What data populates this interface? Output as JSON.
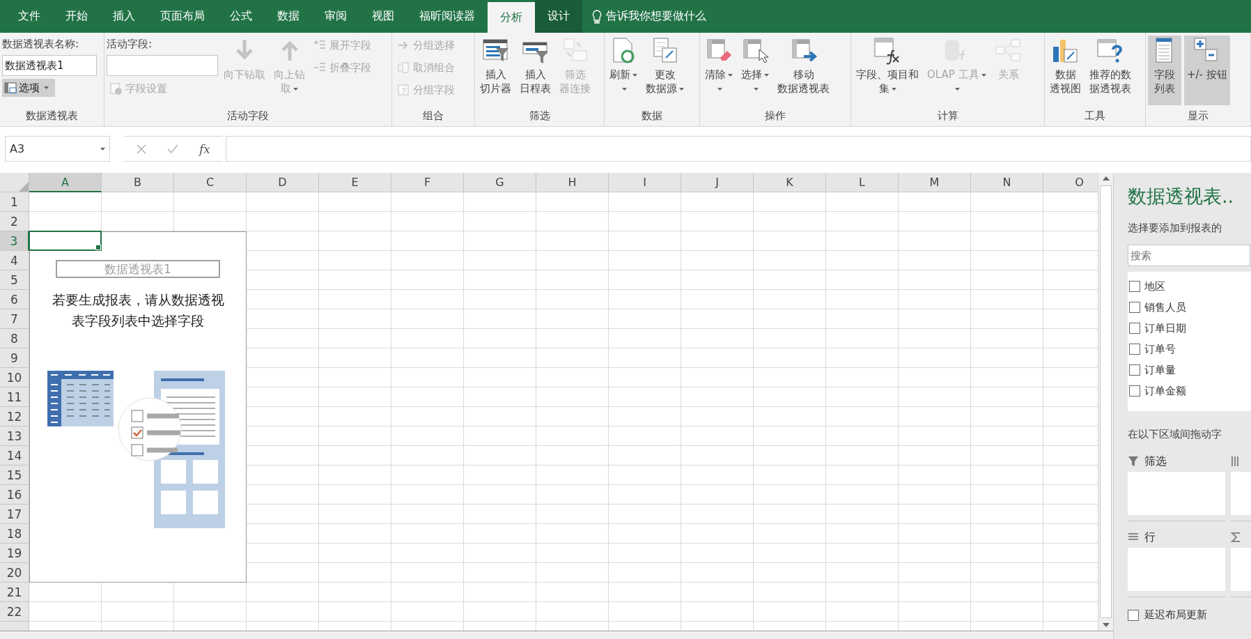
{
  "tabs": [
    {
      "label": "文件",
      "selected": false,
      "contextual": false
    },
    {
      "label": "开始",
      "selected": false,
      "contextual": false
    },
    {
      "label": "插入",
      "selected": false,
      "contextual": false
    },
    {
      "label": "页面布局",
      "selected": false,
      "contextual": false
    },
    {
      "label": "公式",
      "selected": false,
      "contextual": false
    },
    {
      "label": "数据",
      "selected": false,
      "contextual": false
    },
    {
      "label": "审阅",
      "selected": false,
      "contextual": false
    },
    {
      "label": "视图",
      "selected": false,
      "contextual": false
    },
    {
      "label": "福昕阅读器",
      "selected": false,
      "contextual": false
    },
    {
      "label": "分析",
      "selected": true,
      "contextual": true
    },
    {
      "label": "设计",
      "selected": false,
      "contextual": true
    }
  ],
  "tell_me": {
    "placeholder": "告诉我你想要做什么"
  },
  "ribbon": {
    "groups": [
      {
        "label": "数据透视表",
        "columns": [
          [
            {
              "kind": "caption",
              "text": "数据透视表名称:"
            },
            {
              "kind": "input",
              "value": "数据透视表1"
            },
            {
              "kind": "split",
              "text": "选项",
              "selected": true
            }
          ]
        ]
      },
      {
        "label": "活动字段",
        "columns": [
          [
            {
              "kind": "caption",
              "text": "活动字段:"
            },
            {
              "kind": "input"
            },
            {
              "kind": "small",
              "text": "字段设置",
              "disabled": true
            }
          ],
          [
            {
              "kind": "large",
              "lines": [
                "向下钻取"
              ],
              "dropdown": false,
              "disabled": true,
              "selected": false
            }
          ],
          [
            {
              "kind": "large",
              "lines": [
                "向上钻",
                "取"
              ],
              "dropdown": true,
              "disabled": true,
              "selected": false
            }
          ],
          [
            {
              "kind": "small",
              "text": "展开字段",
              "disabled": true
            },
            {
              "kind": "small",
              "text": "折叠字段",
              "disabled": true
            }
          ]
        ]
      },
      {
        "label": "组合",
        "columns": [
          [
            {
              "kind": "small",
              "text": "分组选择",
              "disabled": true
            },
            {
              "kind": "small",
              "text": "取消组合",
              "disabled": true
            },
            {
              "kind": "small",
              "text": "分组字段",
              "disabled": true
            }
          ]
        ]
      },
      {
        "label": "筛选",
        "columns": [
          [
            {
              "kind": "large",
              "lines": [
                "插入",
                "切片器"
              ],
              "dropdown": false,
              "disabled": false,
              "selected": false
            }
          ],
          [
            {
              "kind": "large",
              "lines": [
                "插入",
                "日程表"
              ],
              "dropdown": false,
              "disabled": false,
              "selected": false
            }
          ],
          [
            {
              "kind": "large",
              "lines": [
                "筛选",
                "器连接"
              ],
              "dropdown": false,
              "disabled": true,
              "selected": false
            }
          ]
        ]
      },
      {
        "label": "数据",
        "columns": [
          [
            {
              "kind": "large",
              "lines": [
                "刷新"
              ],
              "dropdown": true,
              "disabled": false,
              "selected": false
            }
          ],
          [
            {
              "kind": "large",
              "lines": [
                "更改",
                "数据源"
              ],
              "dropdown": true,
              "disabled": false,
              "selected": false
            }
          ]
        ]
      },
      {
        "label": "操作",
        "columns": [
          [
            {
              "kind": "large",
              "lines": [
                "清除"
              ],
              "dropdown": true,
              "disabled": false,
              "selected": false
            }
          ],
          [
            {
              "kind": "large",
              "lines": [
                "选择"
              ],
              "dropdown": true,
              "disabled": false,
              "selected": false
            }
          ],
          [
            {
              "kind": "large",
              "lines": [
                "移动",
                "数据透视表"
              ],
              "dropdown": false,
              "disabled": false,
              "selected": false
            }
          ]
        ]
      },
      {
        "label": "计算",
        "columns": [
          [
            {
              "kind": "large",
              "lines": [
                "字段、项目和",
                "集"
              ],
              "dropdown": true,
              "disabled": false,
              "selected": false
            }
          ],
          [
            {
              "kind": "large",
              "lines": [
                "OLAP 工具"
              ],
              "dropdown": true,
              "disabled": true,
              "selected": false
            }
          ],
          [
            {
              "kind": "large",
              "lines": [
                "关系"
              ],
              "dropdown": false,
              "disabled": true,
              "selected": false
            }
          ]
        ]
      },
      {
        "label": "工具",
        "columns": [
          [
            {
              "kind": "large",
              "lines": [
                "数据",
                "透视图"
              ],
              "dropdown": false,
              "disabled": false,
              "selected": false
            }
          ],
          [
            {
              "kind": "large",
              "lines": [
                "推荐的数",
                "据透视表"
              ],
              "dropdown": false,
              "disabled": false,
              "selected": false
            }
          ]
        ]
      },
      {
        "label": "显示",
        "columns": [
          [
            {
              "kind": "large",
              "lines": [
                "字段",
                "列表"
              ],
              "dropdown": false,
              "disabled": false,
              "selected": true
            }
          ],
          [
            {
              "kind": "large",
              "lines": [
                "+/- 按钮"
              ],
              "dropdown": false,
              "disabled": false,
              "selected": true
            }
          ]
        ]
      }
    ]
  },
  "formula_bar": {
    "name_box": "A3",
    "function_button": "fx"
  },
  "sheet": {
    "columns": [
      {
        "label": "A",
        "selected": true
      },
      {
        "label": "B",
        "selected": false
      },
      {
        "label": "C",
        "selected": false
      },
      {
        "label": "D",
        "selected": false
      },
      {
        "label": "E",
        "selected": false
      },
      {
        "label": "F",
        "selected": false
      },
      {
        "label": "G",
        "selected": false
      },
      {
        "label": "H",
        "selected": false
      },
      {
        "label": "I",
        "selected": false
      },
      {
        "label": "J",
        "selected": false
      },
      {
        "label": "K",
        "selected": false
      },
      {
        "label": "L",
        "selected": false
      },
      {
        "label": "M",
        "selected": false
      },
      {
        "label": "N",
        "selected": false
      },
      {
        "label": "O",
        "selected": false
      }
    ],
    "rows": [
      {
        "label": "1",
        "selected": false
      },
      {
        "label": "2",
        "selected": false
      },
      {
        "label": "3",
        "selected": true
      },
      {
        "label": "4",
        "selected": false
      },
      {
        "label": "5",
        "selected": false
      },
      {
        "label": "6",
        "selected": false
      },
      {
        "label": "7",
        "selected": false
      },
      {
        "label": "8",
        "selected": false
      },
      {
        "label": "9",
        "selected": false
      },
      {
        "label": "10",
        "selected": false
      },
      {
        "label": "11",
        "selected": false
      },
      {
        "label": "12",
        "selected": false
      },
      {
        "label": "13",
        "selected": false
      },
      {
        "label": "14",
        "selected": false
      },
      {
        "label": "15",
        "selected": false
      },
      {
        "label": "16",
        "selected": false
      },
      {
        "label": "17",
        "selected": false
      },
      {
        "label": "18",
        "selected": false
      },
      {
        "label": "19",
        "selected": false
      },
      {
        "label": "20",
        "selected": false
      },
      {
        "label": "21",
        "selected": false
      },
      {
        "label": "22",
        "selected": false
      }
    ]
  },
  "pivot_placeholder": {
    "title": "数据透视表1",
    "message": "若要生成报表，请从数据透视表字段列表中选择字段"
  },
  "field_panel": {
    "title": "数据透视表..",
    "subtitle": "选择要添加到报表的",
    "search": {
      "placeholder": "搜索"
    },
    "fields": [
      {
        "label": "地区",
        "checked": false
      },
      {
        "label": "销售人员",
        "checked": false
      },
      {
        "label": "订单日期",
        "checked": false
      },
      {
        "label": "订单号",
        "checked": false
      },
      {
        "label": "订单量",
        "checked": false
      },
      {
        "label": "订单金额",
        "checked": false
      }
    ],
    "areas_hint": "在以下区域间拖动字",
    "areas": [
      {
        "kind": "filter",
        "label": "筛选"
      },
      {
        "kind": "columns"
      },
      {
        "kind": "rows",
        "label": "行"
      },
      {
        "kind": "values"
      }
    ],
    "defer_update": {
      "label": "延迟布局更新",
      "checked": false
    }
  }
}
